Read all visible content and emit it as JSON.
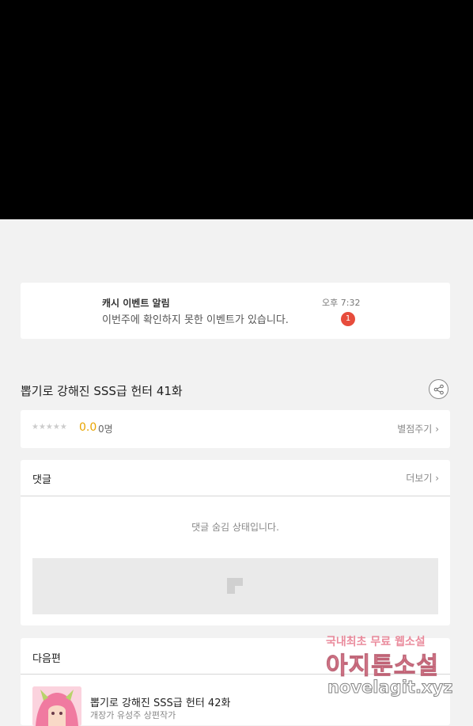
{
  "notification": {
    "title": "캐시 이벤트 알림",
    "time": "오후 7:32",
    "message": "이번주에 확인하지 못한 이벤트가 있습니다.",
    "badge": "1"
  },
  "episode": {
    "title": "뽑기로 강해진 SSS급 헌터 41화"
  },
  "rating": {
    "stars": "★★★★★",
    "score": "0.0",
    "count": "0명",
    "rate_link": "별점주기"
  },
  "comments": {
    "header": "댓글",
    "more": "더보기",
    "hidden_message": "댓글 숨김 상태입니다."
  },
  "next": {
    "header": "다음편",
    "title": "뽑기로 강해진 SSS급 헌터 42화",
    "author": "개장가 유성주 상편작가"
  },
  "watermark": {
    "line1": "국내최초 무료 웹소설",
    "line2": "아지툰소설",
    "line3": "novelagit.xyz"
  }
}
